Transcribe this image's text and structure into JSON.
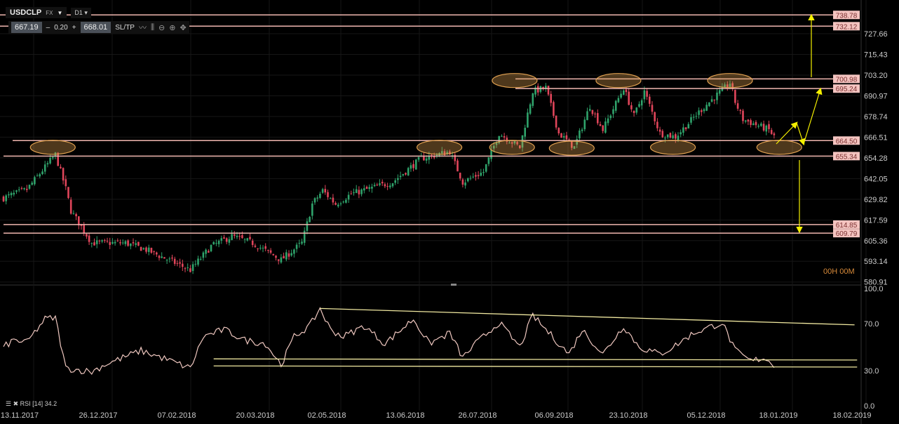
{
  "header": {
    "symbol": "USDCLP",
    "market": "FX",
    "timeframe": "D1",
    "bid": "667.19",
    "spread_minus": "–",
    "spread": "0.20",
    "spread_plus": "+",
    "ask": "668.01",
    "sltp_label": "SL/TP"
  },
  "timer": "00H 00M",
  "rsi_label": "RSI [14] 34.2",
  "colors": {
    "up": "#2fa36b",
    "down": "#e0455a",
    "level": "#f0b7b0",
    "ellipse": "#e0a050",
    "arrow": "#f5f000",
    "rsi": "#f0c8c0",
    "trend": "#f0e8a0"
  },
  "chart_data": [
    {
      "type": "candlestick",
      "title": "USDCLP D1",
      "y_ticks": [
        "727.66",
        "715.43",
        "703.20",
        "690.97",
        "678.74",
        "666.51",
        "654.28",
        "642.05",
        "629.82",
        "617.59",
        "605.36",
        "593.14",
        "580.91"
      ],
      "y_tick_values": [
        727.66,
        715.43,
        703.2,
        690.97,
        678.74,
        666.51,
        654.28,
        642.05,
        629.82,
        617.59,
        605.36,
        593.14,
        580.91
      ],
      "ylim": [
        578,
        742
      ],
      "x_ticks": [
        "13.11.2017",
        "26.12.2017",
        "07.02.2018",
        "20.03.2018",
        "02.05.2018",
        "13.06.2018",
        "26.07.2018",
        "06.09.2018",
        "23.10.2018",
        "05.12.2018",
        "18.01.2019",
        "18.02.2019"
      ],
      "close_path": [
        [
          0,
          630.6
        ],
        [
          9,
          635.6
        ],
        [
          20,
          656.3
        ],
        [
          24,
          636
        ],
        [
          26,
          623
        ],
        [
          34,
          604
        ],
        [
          47,
          604
        ],
        [
          55,
          600
        ],
        [
          72,
          588
        ],
        [
          80,
          602
        ],
        [
          88,
          608
        ],
        [
          96,
          604
        ],
        [
          107,
          594
        ],
        [
          115,
          604
        ],
        [
          119,
          627
        ],
        [
          123,
          635
        ],
        [
          128,
          627
        ],
        [
          134,
          633
        ],
        [
          150,
          640
        ],
        [
          161,
          654
        ],
        [
          172,
          658
        ],
        [
          177,
          640
        ],
        [
          185,
          646
        ],
        [
          191,
          668.8
        ],
        [
          199,
          660.5
        ],
        [
          204,
          693.6
        ],
        [
          209,
          695.7
        ],
        [
          214,
          668.8
        ],
        [
          220,
          660.5
        ],
        [
          226,
          685
        ],
        [
          231,
          671
        ],
        [
          239,
          695.7
        ],
        [
          243,
          679
        ],
        [
          247,
          693.6
        ],
        [
          253,
          668.8
        ],
        [
          259,
          666.7
        ],
        [
          269,
          683
        ],
        [
          280,
          698.6
        ],
        [
          282,
          687.4
        ],
        [
          285,
          677
        ],
        [
          295,
          670.8
        ],
        [
          297,
          666.7
        ]
      ],
      "levels": [
        {
          "value": "738.78"
        },
        {
          "value": "732.12"
        },
        {
          "value": "700.98"
        },
        {
          "value": "695.24"
        },
        {
          "value": "664.50"
        },
        {
          "value": "655.34"
        },
        {
          "value": "614.85"
        },
        {
          "value": "609.79"
        }
      ],
      "ellipses": [
        [
          19,
          660.5
        ],
        [
          168,
          660.5
        ],
        [
          196,
          660.5
        ],
        [
          219,
          660
        ],
        [
          237,
          700
        ],
        [
          258,
          660.5
        ],
        [
          280,
          700
        ],
        [
          197,
          700
        ],
        [
          299,
          660.5
        ]
      ]
    },
    {
      "type": "line",
      "title": "RSI [14]",
      "y_ticks": [
        "100.0",
        "70.0",
        "30.0",
        "0.0"
      ],
      "ylim": [
        0,
        100
      ],
      "values_path": [
        [
          0,
          50
        ],
        [
          4,
          56
        ],
        [
          9,
          54
        ],
        [
          16,
          74
        ],
        [
          20,
          75
        ],
        [
          24,
          32
        ],
        [
          34,
          29
        ],
        [
          39,
          35
        ],
        [
          53,
          47
        ],
        [
          61,
          41
        ],
        [
          72,
          32
        ],
        [
          77,
          59
        ],
        [
          85,
          65
        ],
        [
          93,
          56
        ],
        [
          101,
          53
        ],
        [
          107,
          35
        ],
        [
          112,
          59
        ],
        [
          118,
          68
        ],
        [
          122,
          83
        ],
        [
          126,
          65
        ],
        [
          131,
          59
        ],
        [
          139,
          68
        ],
        [
          147,
          53
        ],
        [
          158,
          74
        ],
        [
          164,
          53
        ],
        [
          172,
          62
        ],
        [
          177,
          41
        ],
        [
          182,
          53
        ],
        [
          191,
          71
        ],
        [
          199,
          50
        ],
        [
          204,
          77
        ],
        [
          209,
          65
        ],
        [
          218,
          44
        ],
        [
          223,
          65
        ],
        [
          231,
          44
        ],
        [
          239,
          68
        ],
        [
          245,
          50
        ],
        [
          253,
          44
        ],
        [
          258,
          50
        ],
        [
          266,
          62
        ],
        [
          277,
          71
        ],
        [
          282,
          47
        ],
        [
          288,
          38
        ],
        [
          293,
          41
        ],
        [
          297,
          35
        ]
      ],
      "trendlines": [
        [
          [
            122,
            83
          ],
          [
            328,
            69
          ]
        ],
        [
          [
            81,
            40
          ],
          [
            329,
            39
          ]
        ],
        [
          [
            81,
            34
          ],
          [
            329,
            33
          ]
        ]
      ]
    }
  ]
}
